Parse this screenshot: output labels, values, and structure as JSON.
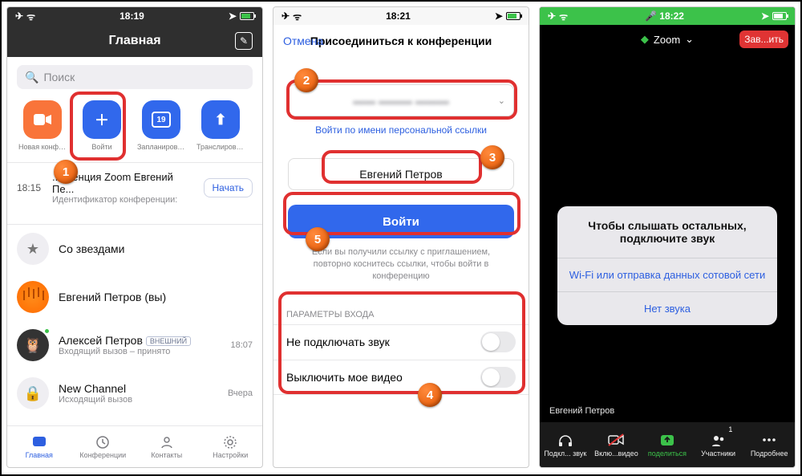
{
  "s1": {
    "status": {
      "time": "18:19"
    },
    "nav_title": "Главная",
    "search_placeholder": "Поиск",
    "actions": {
      "new": "Новая конференция",
      "join": "Войти",
      "schedule": "Запланировать",
      "cast": "Транслировать э..."
    },
    "calendar_day": "19",
    "meeting": {
      "time": "18:15",
      "title": "...еренция Zoom Евгений Пе...",
      "subtitle": "Идентификатор конференции:",
      "start": "Начать"
    },
    "rows": {
      "starred": "Со звездами",
      "me": "Евгений Петров (вы)",
      "contact": "Алексей Петров",
      "ext": "ВНЕШНИЙ",
      "contact_sub": "Входящий вызов – принято",
      "contact_time": "18:07",
      "channel": "New Channel",
      "channel_sub": "Исходящий вызов",
      "channel_time": "Вчера"
    },
    "tabs": {
      "home": "Главная",
      "meet": "Конференции",
      "contacts": "Контакты",
      "settings": "Настройки"
    }
  },
  "s2": {
    "status_time": "18:21",
    "cancel": "Отмена",
    "title": "Присоединиться к конференции",
    "id_placeholder": "▬▬ ▬▬▬ ▬▬▬",
    "link": "Войти по имени персональной ссылки",
    "name": "Евгений Петров",
    "join": "Войти",
    "hint": "Если вы получили ссылку с приглашением, повторно коснитесь ссылки, чтобы войти в конференцию",
    "section": "ПАРАМЕТРЫ ВХОДА",
    "opt_audio": "Не подключать звук",
    "opt_video": "Выключить мое видео"
  },
  "s3": {
    "status_time": "18:22",
    "app": "Zoom",
    "leave": "Зав...ить",
    "alert_title": "Чтобы слышать остальных, подключите звук",
    "alert_wifi": "Wi-Fi или отправка данных сотовой сети",
    "alert_none": "Нет звука",
    "caption": "Евгений Петров",
    "bar": {
      "audio": "Подкл... звук",
      "video": "Вклю...видео",
      "share": "поделиться",
      "part": "Участники",
      "more": "Подробнее",
      "count": "1"
    }
  },
  "steps": {
    "n1": "1",
    "n2": "2",
    "n3": "3",
    "n4": "4",
    "n5": "5"
  }
}
